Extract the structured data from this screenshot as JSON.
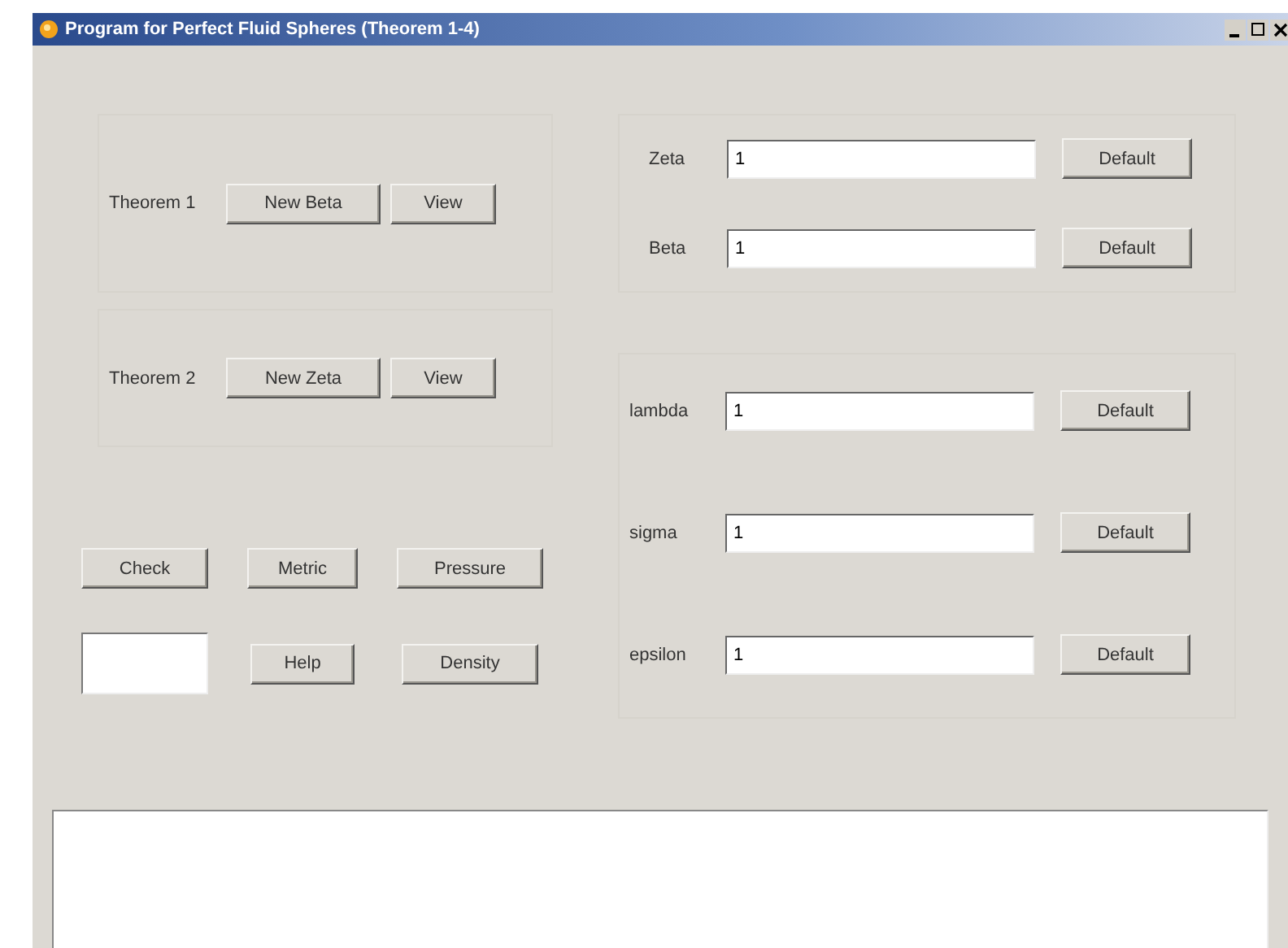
{
  "window": {
    "title": "Program for Perfect Fluid Spheres (Theorem 1-4)"
  },
  "theorems": [
    {
      "label": "Theorem 1",
      "buttons": [
        "New Beta",
        "View"
      ]
    },
    {
      "label": "Theorem 2",
      "buttons": [
        "New Zeta",
        "View"
      ]
    }
  ],
  "actions": {
    "row_1": [
      "Check",
      "Metric",
      "Pressure"
    ],
    "row_2": [
      "Help",
      "Density"
    ]
  },
  "upper_parameters": [
    {
      "label": "Zeta",
      "value": "1",
      "button": "Default"
    },
    {
      "label": "Beta",
      "value": "1",
      "button": "Default"
    }
  ],
  "lower_parameters": [
    {
      "label": "lambda",
      "value": "1",
      "button": "Default"
    },
    {
      "label": "sigma",
      "value": "1",
      "button": "Default"
    },
    {
      "label": "epsilon",
      "value": "1",
      "button": "Default"
    }
  ]
}
